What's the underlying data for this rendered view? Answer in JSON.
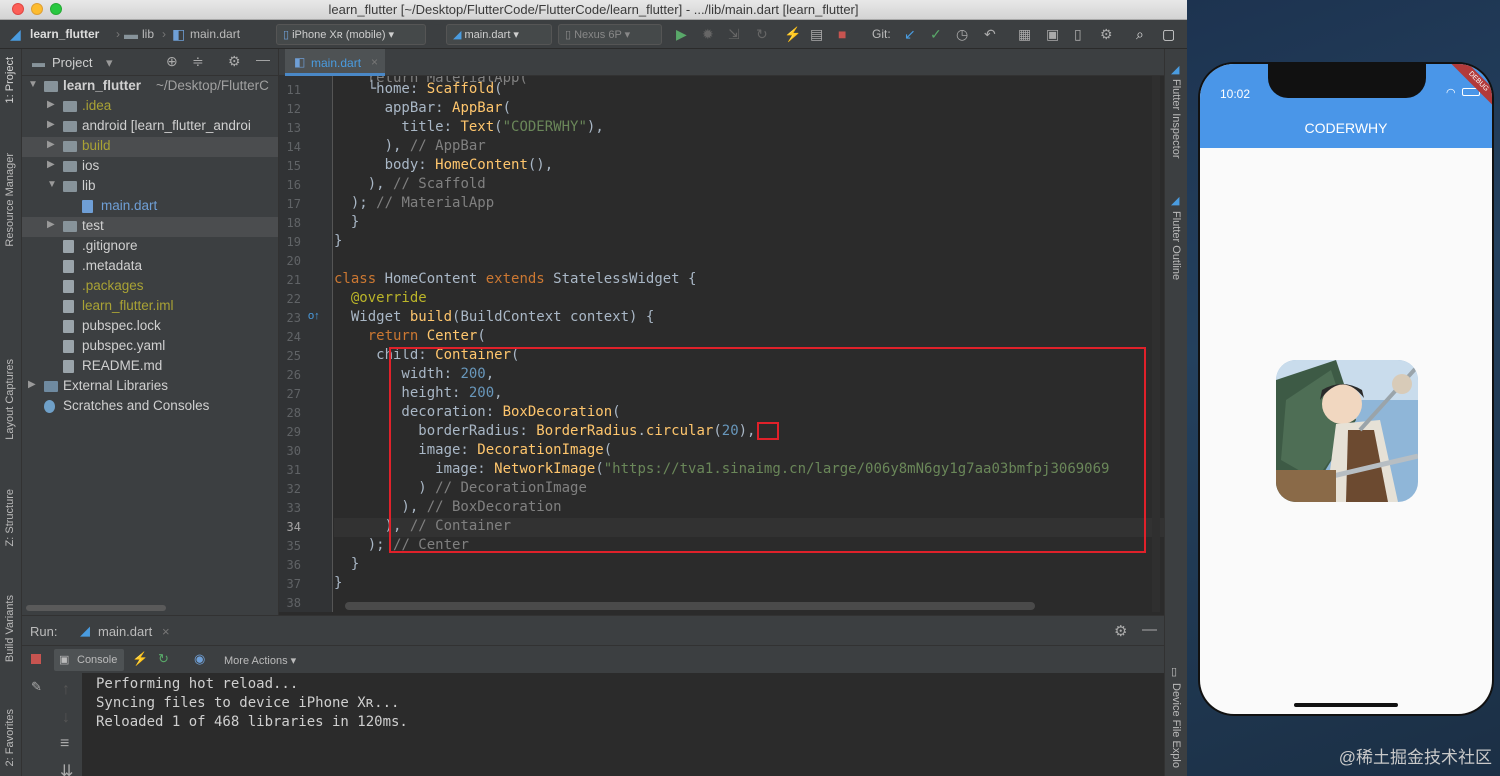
{
  "window": {
    "title": "learn_flutter [~/Desktop/FlutterCode/FlutterCode/learn_flutter] - .../lib/main.dart [learn_flutter]"
  },
  "toolbar": {
    "breadcrumb": [
      "learn_flutter",
      "lib",
      "main.dart"
    ],
    "device": "iPhone Xʀ (mobile)",
    "run_config": "main.dart",
    "emulator": "Nexus 6P",
    "git_label": "Git:"
  },
  "left_strip": {
    "project_tab": "1: Project",
    "resource_manager": "Resource Manager",
    "layout_captures": "Layout Captures",
    "structure": "Z: Structure",
    "build_variants": "Build Variants",
    "favorites": "2: Favorites"
  },
  "right_strip": {
    "flutter_inspector": "Flutter Inspector",
    "flutter_outline": "Flutter Outline",
    "device_file_explorer": "Device File Explo"
  },
  "project_panel": {
    "header": "Project",
    "root": {
      "name": "learn_flutter",
      "path": "~/Desktop/FlutterC"
    },
    "items": [
      {
        "label": ".idea",
        "color": "#a9a235"
      },
      {
        "label": "android [learn_flutter_androi",
        "color": "#d0d0d0"
      },
      {
        "label": "build",
        "color": "#a9a235"
      },
      {
        "label": "ios",
        "color": "#d0d0d0"
      },
      {
        "label": "lib",
        "color": "#d0d0d0"
      },
      {
        "label": "main.dart",
        "color": "#6f9fd6"
      },
      {
        "label": "test",
        "color": "#d0d0d0"
      },
      {
        "label": ".gitignore",
        "color": "#d0d0d0"
      },
      {
        "label": ".metadata",
        "color": "#d0d0d0"
      },
      {
        "label": ".packages",
        "color": "#a9a235"
      },
      {
        "label": "learn_flutter.iml",
        "color": "#a9a235"
      },
      {
        "label": "pubspec.lock",
        "color": "#d0d0d0"
      },
      {
        "label": "pubspec.yaml",
        "color": "#d0d0d0"
      },
      {
        "label": "README.md",
        "color": "#d0d0d0"
      },
      {
        "label": "External Libraries",
        "color": "#d0d0d0"
      },
      {
        "label": "Scratches and Consoles",
        "color": "#d0d0d0"
      }
    ]
  },
  "editor": {
    "tab": "main.dart",
    "line_numbers": [
      "11",
      "12",
      "13",
      "14",
      "15",
      "16",
      "17",
      "18",
      "19",
      "20",
      "21",
      "22",
      "23",
      "24",
      "25",
      "26",
      "27",
      "28",
      "29",
      "30",
      "31",
      "32",
      "33",
      "34",
      "35",
      "36",
      "37",
      "38"
    ],
    "current_line": "34"
  },
  "run_panel": {
    "label": "Run:",
    "tab": "main.dart",
    "console_tab": "Console",
    "more_actions": "More Actions",
    "output": [
      "Performing hot reload...",
      "Syncing files to device iPhone Xʀ...",
      "Reloaded 1 of 468 libraries in 120ms."
    ]
  },
  "phone": {
    "time": "10:02",
    "app_title": "CODERWHY",
    "debug_banner": "DEBUG"
  },
  "watermark": "@稀土掘金技术社区"
}
